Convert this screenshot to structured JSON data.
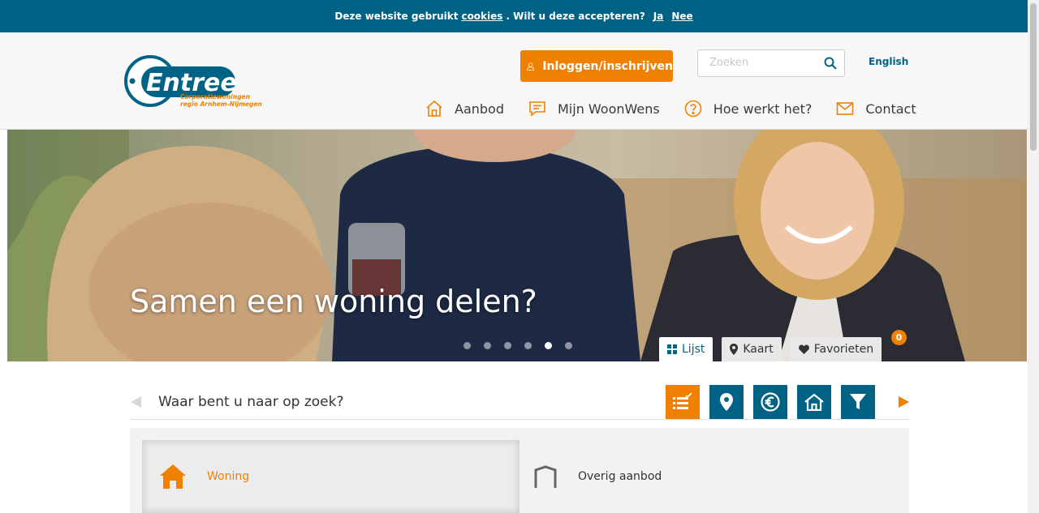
{
  "cookie_bar": {
    "text_before": "Deze website gebruikt",
    "link": "cookies",
    "text_after": ". Wilt u deze accepteren?",
    "yes": "Ja",
    "no": "Nee"
  },
  "header": {
    "logo": {
      "name": "Entree",
      "tagline_line1": "Corporatiewoningen",
      "tagline_line2": "regio Arnhem-Nijmegen"
    },
    "login_label": "Inloggen/inschrijven",
    "search_placeholder": "Zoeken",
    "language": "English",
    "nav": [
      {
        "label": "Aanbod",
        "icon": "house-icon"
      },
      {
        "label": "Mijn WoonWens",
        "icon": "chat-icon"
      },
      {
        "label": "Hoe werkt het?",
        "icon": "question-icon"
      },
      {
        "label": "Contact",
        "icon": "mail-icon"
      }
    ]
  },
  "hero": {
    "title": "Samen een woning delen?",
    "slides": 6,
    "active_slide": 5
  },
  "view_tabs": [
    {
      "label": "Lijst",
      "icon": "grid-icon",
      "active": true
    },
    {
      "label": "Kaart",
      "icon": "map-pin-icon",
      "active": false
    },
    {
      "label": "Favorieten",
      "icon": "heart-icon",
      "active": false
    }
  ],
  "favorites_count": "0",
  "search_panel": {
    "title": "Waar bent u naar op zoek?",
    "steps": [
      {
        "icon": "list-check-icon",
        "active": true
      },
      {
        "icon": "location-icon",
        "active": false
      },
      {
        "icon": "euro-icon",
        "active": false
      },
      {
        "icon": "house-icon",
        "active": false
      },
      {
        "icon": "filter-icon",
        "active": false
      }
    ]
  },
  "types": [
    {
      "label": "Woning",
      "icon": "house-icon",
      "selected": true
    },
    {
      "label": "Overig aanbod",
      "icon": "garage-icon",
      "selected": false
    }
  ],
  "colors": {
    "brand_blue": "#006385",
    "accent_orange": "#f08100"
  }
}
